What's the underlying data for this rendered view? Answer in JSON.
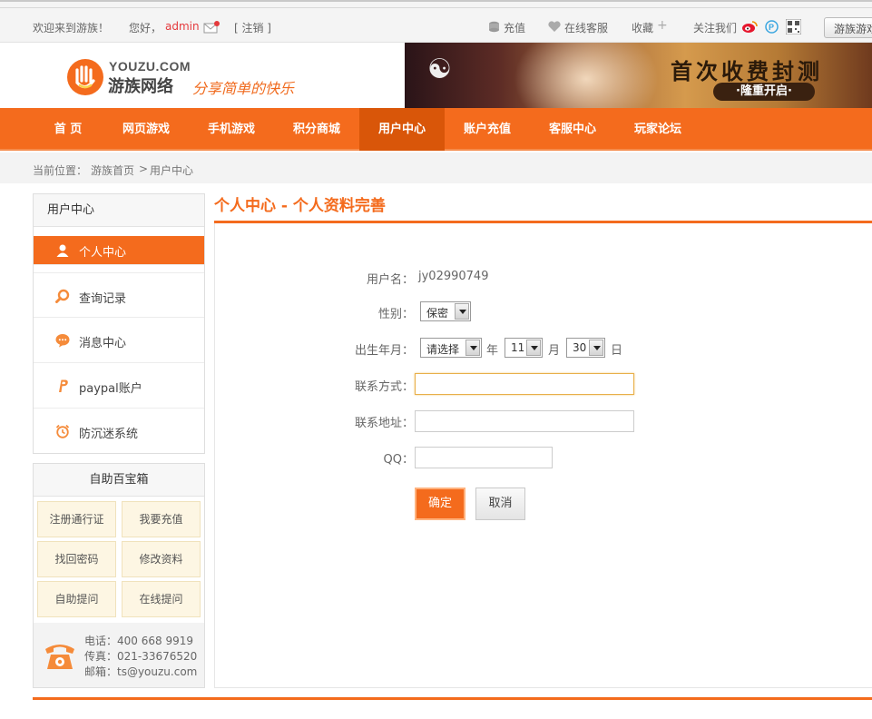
{
  "topbar": {
    "welcome": "欢迎来到游族！",
    "hello": "您好，",
    "username": "admin",
    "logout": "[ 注销 ]",
    "recharge": "充值",
    "service": "在线客服",
    "favorite": "收藏",
    "follow": "关注我们",
    "right_button": "游族游戏"
  },
  "header": {
    "logo_en": "YOUZU.COM",
    "logo_cn": "游族网络",
    "slogan": "分享简单的快乐",
    "banner_title": "首次收费封测",
    "banner_sub": "·隆重开启·"
  },
  "nav": {
    "items": [
      "首 页",
      "网页游戏",
      "手机游戏",
      "积分商城",
      "用户中心",
      "账户充值",
      "客服中心",
      "玩家论坛"
    ],
    "active_index": 4
  },
  "breadcrumb": {
    "label": "当前位置：",
    "home": "游族首页",
    "sep": ">",
    "current": "用户中心"
  },
  "sidebar": {
    "title": "用户中心",
    "items": [
      {
        "label": "个人中心",
        "icon": "user-icon"
      },
      {
        "label": "查询记录",
        "icon": "search-icon"
      },
      {
        "label": "消息中心",
        "icon": "message-icon"
      },
      {
        "label": "paypal账户",
        "icon": "paypal-icon"
      },
      {
        "label": "防沉迷系统",
        "icon": "alarm-clock-icon"
      }
    ]
  },
  "toolbox": {
    "title": "自助百宝箱",
    "buttons": [
      "注册通行证",
      "我要充值",
      "找回密码",
      "修改资料",
      "自助提问",
      "在线提问"
    ],
    "phone": "电话：400 668 9919",
    "fax": "传真：021-33676520",
    "email": "邮箱：ts@youzu.com"
  },
  "main": {
    "title": "个人中心 - 个人资料完善",
    "form": {
      "username_label": "用户名：",
      "username_value": "jy02990749",
      "gender_label": "性别：",
      "gender_value": "保密",
      "birth_label": "出生年月：",
      "year_value": "请选择",
      "year_unit": "年",
      "month_value": "11",
      "month_unit": "月",
      "day_value": "30",
      "day_unit": "日",
      "contact_label": "联系方式：",
      "contact_value": "",
      "address_label": "联系地址：",
      "address_value": "",
      "qq_label": "QQ：",
      "qq_value": "",
      "submit": "确定",
      "cancel": "取消"
    }
  },
  "colors": {
    "accent": "#f46b1d",
    "accent_dark": "#d95609",
    "username_red": "#e4393c"
  }
}
